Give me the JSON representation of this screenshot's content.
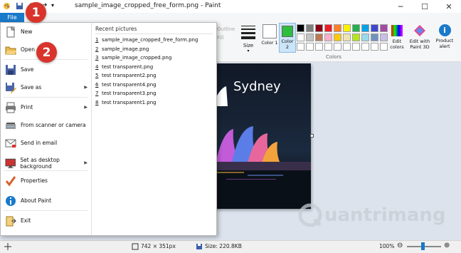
{
  "window": {
    "title": "sample_image_cropped_free_form.png - Paint",
    "minimize_icon": "minimize-icon",
    "maximize_icon": "maximize-icon",
    "close_icon": "close-icon"
  },
  "ribbon": {
    "file_tab": "File",
    "outline_label": "Outline",
    "fill_label": "Fill",
    "size_label": "Size",
    "color1_label": "Color 1",
    "color2_label": "Color 2",
    "colors_group": "Colors",
    "edit_colors": "Edit colors",
    "edit_paint3d": "Edit with Paint 3D",
    "product_alert": "Product alert",
    "color2_value": "#2ebd3d",
    "palette": [
      "#000000",
      "#7f7f7f",
      "#880015",
      "#ed1c24",
      "#ff7f27",
      "#fff200",
      "#22b14c",
      "#00a2e8",
      "#3f48cc",
      "#a349a4",
      "#ffffff",
      "#c3c3c3",
      "#b97a57",
      "#ffaec9",
      "#ffc90e",
      "#efe4b0",
      "#b5e61d",
      "#99d9ea",
      "#7092be",
      "#c8bfe7"
    ]
  },
  "menu": {
    "items": [
      {
        "label": "New",
        "icon": "new-file-icon"
      },
      {
        "label": "Open",
        "icon": "open-folder-icon"
      },
      {
        "label": "Save",
        "icon": "save-disk-icon"
      },
      {
        "label": "Save as",
        "icon": "save-as-icon"
      },
      {
        "label": "Print",
        "icon": "printer-icon"
      },
      {
        "label": "From scanner or camera",
        "icon": "scanner-icon"
      },
      {
        "label": "Send in email",
        "icon": "email-icon"
      },
      {
        "label": "Set as desktop background",
        "icon": "desktop-background-icon"
      },
      {
        "label": "Properties",
        "icon": "properties-check-icon"
      },
      {
        "label": "About Paint",
        "icon": "info-icon"
      },
      {
        "label": "Exit",
        "icon": "exit-icon"
      }
    ],
    "recent_header": "Recent pictures",
    "recent": [
      {
        "num": "1",
        "name": "sample_image_cropped_free_form.png"
      },
      {
        "num": "2",
        "name": "sample_image.png"
      },
      {
        "num": "3",
        "name": "sample_image_cropped.png"
      },
      {
        "num": "4",
        "name": "test transparent.png"
      },
      {
        "num": "5",
        "name": "test transparent2.png"
      },
      {
        "num": "6",
        "name": "test transparent4.png"
      },
      {
        "num": "7",
        "name": "test transparent3.png"
      },
      {
        "num": "8",
        "name": "test transparent1.png"
      }
    ]
  },
  "canvas": {
    "caption": "Sydney"
  },
  "status": {
    "dimensions": "742 × 351px",
    "size": "Size: 220.8KB",
    "zoom": "100%"
  },
  "annotations": {
    "badge1": "1",
    "badge2": "2"
  },
  "watermark": {
    "text": "uantrimang"
  }
}
